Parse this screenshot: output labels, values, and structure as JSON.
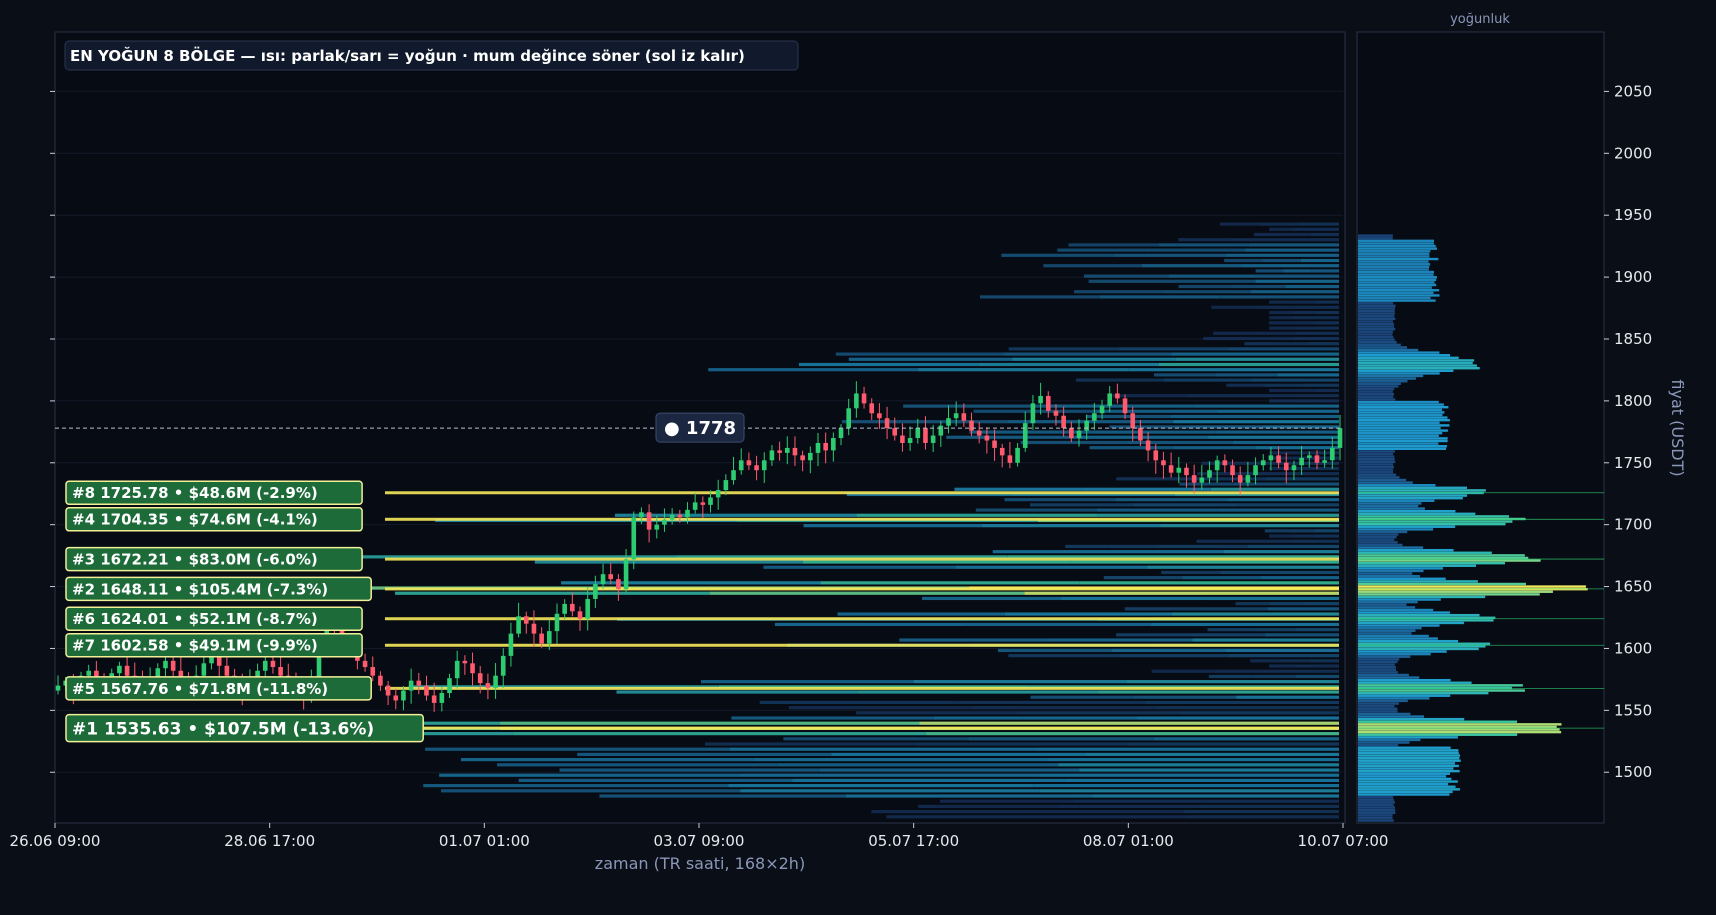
{
  "chart_data": {
    "type": "heatmap",
    "title": "EN YOĞUN 8 BÖLGE — ısı: parlak/sarı = yoğun · mum değince söner (sol iz kalır)",
    "xlabel": "zaman (TR saati, 168×2h)",
    "ylabel": "fiyat (USDT)",
    "profile_label": "yoğunluk",
    "x_ticks": [
      "26.06 09:00",
      "28.06 17:00",
      "01.07 01:00",
      "03.07 09:00",
      "05.07 17:00",
      "08.07 01:00",
      "10.07 07:00"
    ],
    "y_ticks": [
      1500,
      1550,
      1600,
      1650,
      1700,
      1750,
      1800,
      1850,
      1900,
      1950,
      2000,
      2050
    ],
    "ylim": [
      1459,
      2098
    ],
    "candles_total": 168,
    "current_price": 1778,
    "current_price_label": "● 1778",
    "zones": [
      {
        "rank": 1,
        "label": "#1  1535.63  •  $107.5M  (-13.6%)",
        "price": 1535.63,
        "value_musd": 107.5,
        "pct": -13.6
      },
      {
        "rank": 2,
        "label": "#2  1648.11  •  $105.4M  (-7.3%)",
        "price": 1648.11,
        "value_musd": 105.4,
        "pct": -7.3
      },
      {
        "rank": 3,
        "label": "#3  1672.21  •  $83.0M  (-6.0%)",
        "price": 1672.21,
        "value_musd": 83.0,
        "pct": -6.0
      },
      {
        "rank": 4,
        "label": "#4  1704.35  •  $74.6M  (-4.1%)",
        "price": 1704.35,
        "value_musd": 74.6,
        "pct": -4.1
      },
      {
        "rank": 5,
        "label": "#5  1567.76  •  $71.8M  (-11.8%)",
        "price": 1567.76,
        "value_musd": 71.8,
        "pct": -11.8
      },
      {
        "rank": 6,
        "label": "#6  1624.01  •  $52.1M  (-8.7%)",
        "price": 1624.01,
        "value_musd": 52.1,
        "pct": -8.7
      },
      {
        "rank": 7,
        "label": "#7  1602.58  •  $49.1M  (-9.9%)",
        "price": 1602.58,
        "value_musd": 49.1,
        "pct": -9.9
      },
      {
        "rank": 8,
        "label": "#8  1725.78  •  $48.6M  (-2.9%)",
        "price": 1725.78,
        "value_musd": 48.6,
        "pct": -2.9
      }
    ],
    "price_path": [
      1570,
      1574,
      1566,
      1578,
      1582,
      1575,
      1571,
      1580,
      1586,
      1578,
      1572,
      1568,
      1576,
      1584,
      1590,
      1582,
      1576,
      1570,
      1578,
      1588,
      1594,
      1586,
      1578,
      1570,
      1565,
      1574,
      1582,
      1590,
      1585,
      1578,
      1572,
      1568,
      1560,
      1572,
      1600,
      1620,
      1615,
      1606,
      1598,
      1590,
      1585,
      1578,
      1570,
      1562,
      1558,
      1566,
      1574,
      1570,
      1562,
      1556,
      1564,
      1576,
      1590,
      1588,
      1580,
      1572,
      1568,
      1578,
      1594,
      1612,
      1626,
      1620,
      1612,
      1604,
      1614,
      1628,
      1636,
      1630,
      1624,
      1640,
      1652,
      1660,
      1656,
      1648,
      1672,
      1706,
      1710,
      1696,
      1700,
      1704,
      1708,
      1706,
      1712,
      1718,
      1716,
      1722,
      1728,
      1736,
      1744,
      1752,
      1748,
      1744,
      1752,
      1760,
      1758,
      1762,
      1756,
      1752,
      1758,
      1766,
      1760,
      1770,
      1778,
      1794,
      1806,
      1798,
      1790,
      1786,
      1778,
      1772,
      1766,
      1770,
      1778,
      1766,
      1772,
      1780,
      1786,
      1790,
      1784,
      1776,
      1772,
      1768,
      1762,
      1756,
      1750,
      1762,
      1782,
      1798,
      1804,
      1792,
      1788,
      1778,
      1770,
      1776,
      1784,
      1790,
      1796,
      1806,
      1802,
      1790,
      1778,
      1768,
      1760,
      1752,
      1748,
      1742,
      1746,
      1740,
      1734,
      1738,
      1744,
      1752,
      1748,
      1740,
      1734,
      1740,
      1748,
      1752,
      1756,
      1750,
      1744,
      1748,
      1754,
      1756,
      1750,
      1752,
      1762,
      1778
    ],
    "colors": {
      "background": "#0a0e17",
      "up": "#2ecc71",
      "down": "#ff5a6e",
      "zone_fill": "#1e6b3a",
      "zone_border": "#f2f097",
      "heat_low": "#1a2e63",
      "heat_mid": "#1e9bd0",
      "heat_high": "#3ac8a0",
      "heat_peak": "#f6e95b"
    }
  }
}
